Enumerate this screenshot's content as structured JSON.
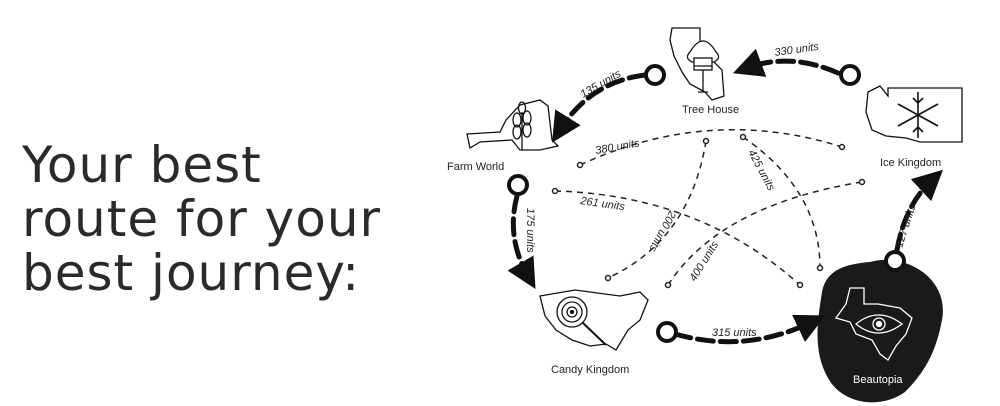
{
  "headline": {
    "line1": "Your best",
    "line2": "route for your",
    "line3": "best journey:"
  },
  "places": {
    "tree_house": "Tree House",
    "farm_world": "Farm World",
    "ice_kingdom": "Ice Kingdom",
    "candy_kingdom": "Candy Kingdom",
    "beautopia": "Beautopia"
  },
  "route": {
    "ice_to_tree": "330 units",
    "tree_to_farm": "135 units",
    "farm_to_candy": "175 units",
    "candy_to_beautopia": "315 units",
    "beautopia_to_ice": "127 units"
  },
  "alternates": {
    "farm_ice": "380 units",
    "tree_beautopia": "425 units",
    "farm_beautopia": "261 units",
    "tree_candy": "200 units",
    "candy_ice": "400 units"
  },
  "colors": {
    "ink": "#111111",
    "blob": "#1a1a1a",
    "text": "#2a2a2a"
  }
}
